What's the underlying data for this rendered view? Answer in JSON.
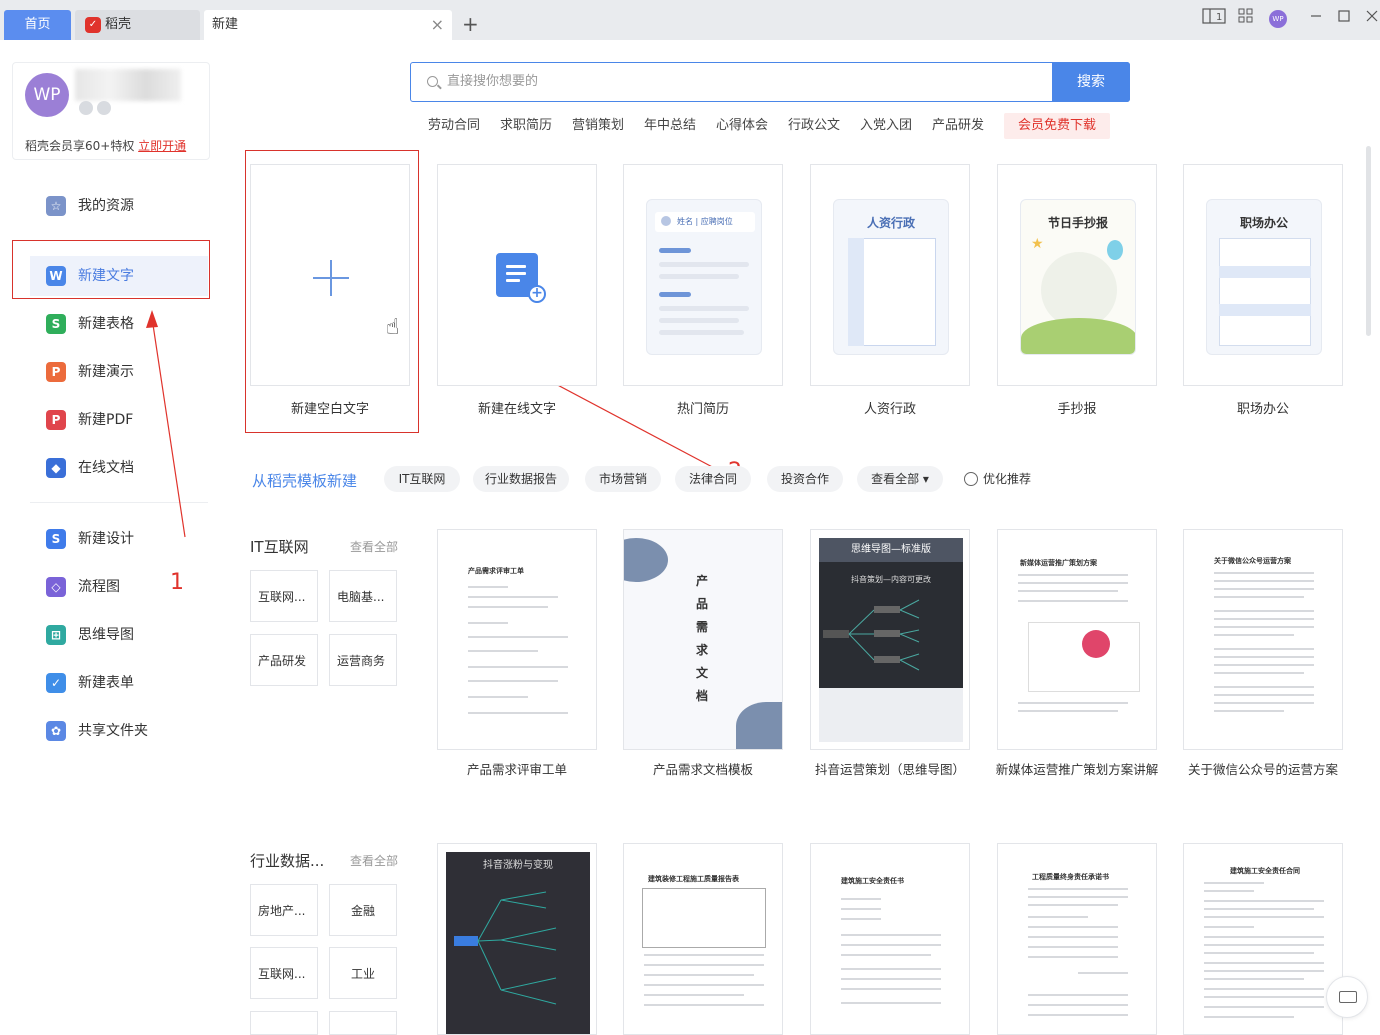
{
  "tabs": {
    "home": "首页",
    "daoke": "稻壳",
    "new": "新建",
    "close": "×",
    "add": "+"
  },
  "window": {
    "layout_toggle": "1",
    "user_badge": "WP"
  },
  "user": {
    "avatar": "WP",
    "vip_text": "稻壳会员享60+特权",
    "vip_link": "立即开通"
  },
  "sidebar": {
    "items": [
      {
        "label": "我的资源",
        "icon": "star-icon",
        "color": "#7b93c9"
      },
      {
        "label": "新建文字",
        "icon": "word-icon",
        "color": "#4a86e8",
        "active": true
      },
      {
        "label": "新建表格",
        "icon": "sheet-icon",
        "color": "#2fae5b"
      },
      {
        "label": "新建演示",
        "icon": "slides-icon",
        "color": "#ec6b3c"
      },
      {
        "label": "新建PDF",
        "icon": "pdf-icon",
        "color": "#e0454c"
      },
      {
        "label": "在线文档",
        "icon": "cloud-doc-icon",
        "color": "#3a6fd8"
      },
      {
        "label": "新建设计",
        "icon": "design-icon",
        "color": "#3f7bea"
      },
      {
        "label": "流程图",
        "icon": "flowchart-icon",
        "color": "#7a63d8"
      },
      {
        "label": "思维导图",
        "icon": "mindmap-icon",
        "color": "#2fa9a0"
      },
      {
        "label": "新建表单",
        "icon": "form-icon",
        "color": "#3f8ee8"
      },
      {
        "label": "共享文件夹",
        "icon": "share-folder-icon",
        "color": "#5b88e4"
      }
    ]
  },
  "search": {
    "placeholder": "直接搜你想要的",
    "button": "搜索"
  },
  "hot_words": [
    "劳动合同",
    "求职简历",
    "营销策划",
    "年中总结",
    "心得体会",
    "行政公文",
    "入党入团",
    "产品研发"
  ],
  "vip_free": "会员免费下载",
  "top_cards": [
    {
      "label": "新建空白文字"
    },
    {
      "label": "新建在线文字"
    },
    {
      "label": "热门简历",
      "thumb_text": "姓名 | 应聘岗位"
    },
    {
      "label": "人资行政",
      "thumb_title": "人资行政"
    },
    {
      "label": "手抄报",
      "thumb_title": "节日手抄报"
    },
    {
      "label": "职场办公",
      "thumb_title": "职场办公"
    }
  ],
  "category": {
    "from_daoke": "从稻壳模板新建",
    "chips": [
      "IT互联网",
      "行业数据报告",
      "市场营销",
      "法律合同",
      "投资合作",
      "查看全部 ▾"
    ],
    "optimize": "优化推荐"
  },
  "annotations": {
    "arrow1": "1",
    "arrow2": "2"
  },
  "sections": [
    {
      "title": "IT互联网",
      "see_all": "查看全部",
      "sub": [
        "互联网...",
        "电脑基...",
        "产品研发",
        "运营商务"
      ],
      "templates": [
        {
          "label": "产品需求评审工单",
          "thumb": "产品需求评审工单"
        },
        {
          "label": "产品需求文档模板",
          "thumb": "产品需求文档"
        },
        {
          "label": "抖音运营策划（思维导图）",
          "thumb": "思维导图—标准版",
          "thumb2": "抖音策划—内容可更改"
        },
        {
          "label": "新媒体运营推广策划方案讲解",
          "thumb": "新媒体运营推广策划方案"
        },
        {
          "label": "关于微信公众号的运营方案",
          "thumb": "关于微信公众号运营方案"
        }
      ]
    },
    {
      "title": "行业数据...",
      "see_all": "查看全部",
      "sub": [
        "房地产...",
        "金融",
        "互联网...",
        "工业"
      ],
      "templates": [
        {
          "thumb": "抖音涨粉与变现"
        },
        {
          "thumb": "建筑装修工程施工质量报告表"
        },
        {
          "thumb": "建筑施工安全责任书"
        },
        {
          "thumb": "工程质量终身责任承诺书"
        },
        {
          "thumb": "建筑施工安全责任合同"
        }
      ]
    }
  ]
}
